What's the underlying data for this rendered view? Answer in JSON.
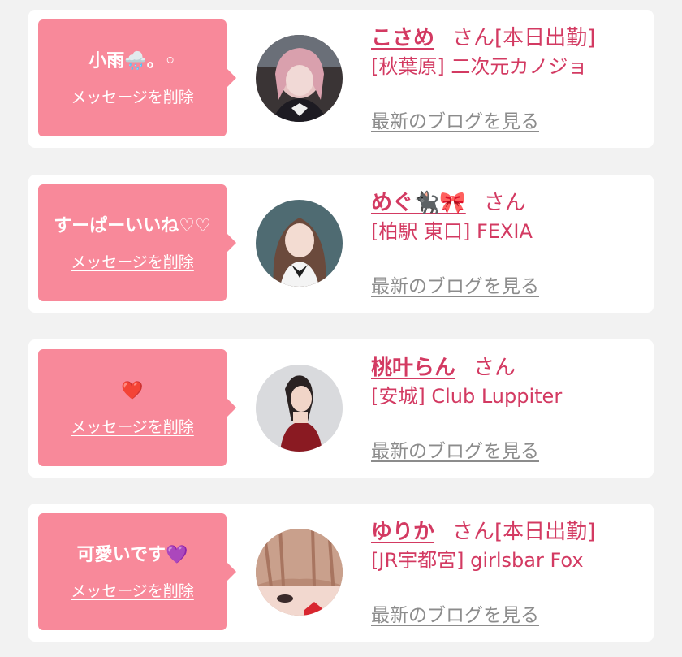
{
  "cards": [
    {
      "message": "小雨🌧️。◦",
      "delete_label": "メッセージを削除",
      "name": "こさめ",
      "honorific": "さん",
      "status": "[本日出勤]",
      "shop": "[秋葉原] 二次元カノジョ",
      "blog_label": "最新のブログを見る"
    },
    {
      "message": "すーぱーいいね♡♡",
      "delete_label": "メッセージを削除",
      "name": "めぐ🐈‍⬛🎀",
      "honorific": "さん",
      "status": "",
      "shop": "[柏駅 東口] FEXIA",
      "blog_label": "最新のブログを見る"
    },
    {
      "message": "❤️",
      "delete_label": "メッセージを削除",
      "name": "桃叶らん",
      "honorific": "さん",
      "status": "",
      "shop": "[安城] Club Luppiter",
      "blog_label": "最新のブログを見る"
    },
    {
      "message": "可愛いです💜",
      "delete_label": "メッセージを削除",
      "name": "ゆりか",
      "honorific": "さん",
      "status": "[本日出勤]",
      "shop": "[JR宇都宮] girlsbar Fox",
      "blog_label": "最新のブログを見る"
    }
  ],
  "colors": {
    "bubble": "#f8899a",
    "accent": "#d33a62",
    "link_gray": "#8c8c8c",
    "background": "#f2f2f2"
  }
}
